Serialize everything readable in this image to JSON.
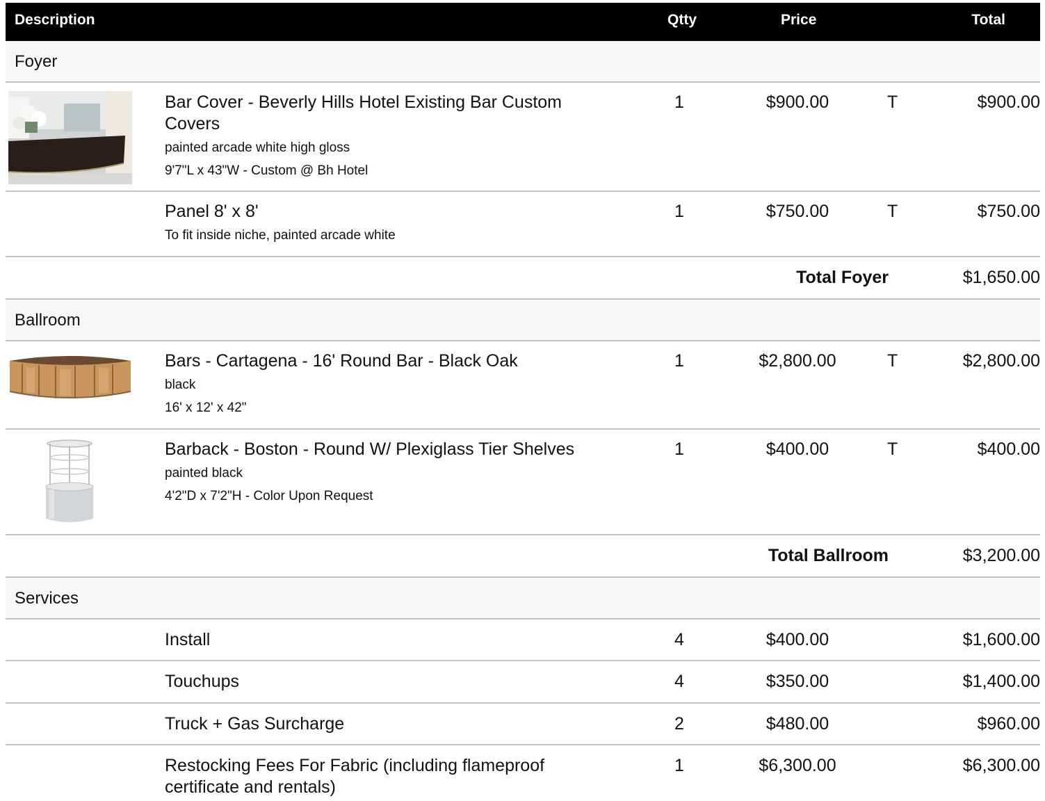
{
  "header": {
    "description": "Description",
    "qty": "Qtty",
    "price": "Price",
    "total": "Total"
  },
  "sections": [
    {
      "name": "Foyer",
      "items": [
        {
          "title": "Bar Cover  - Beverly Hills Hotel Existing Bar Custom Covers",
          "sub1": "painted arcade white high gloss",
          "sub2": "9'7\"L x 43\"W - Custom @ Bh Hotel",
          "qty": "1",
          "price": "$900.00",
          "tax": "T",
          "total": "$900.00"
        },
        {
          "title": "Panel 8' x 8'",
          "sub1": "To fit inside niche, painted arcade white",
          "qty": "1",
          "price": "$750.00",
          "tax": "T",
          "total": "$750.00"
        }
      ],
      "total_label": "Total Foyer",
      "total_value": "$1,650.00"
    },
    {
      "name": "Ballroom",
      "items": [
        {
          "title": "Bars - Cartagena - 16' Round Bar - Black Oak",
          "sub1": "black",
          "sub2": "16' x 12' x 42\"",
          "qty": "1",
          "price": "$2,800.00",
          "tax": "T",
          "total": "$2,800.00"
        },
        {
          "title": "Barback - Boston - Round W/ Plexiglass Tier Shelves",
          "sub1": "painted black",
          "sub2": "4'2\"D x 7'2\"H - Color Upon Request",
          "qty": "1",
          "price": "$400.00",
          "tax": "T",
          "total": "$400.00"
        }
      ],
      "total_label": "Total Ballroom",
      "total_value": "$3,200.00"
    },
    {
      "name": "Services",
      "items": [
        {
          "title": "Install",
          "qty": "4",
          "price": "$400.00",
          "total": "$1,600.00"
        },
        {
          "title": "Touchups",
          "qty": "4",
          "price": "$350.00",
          "total": "$1,400.00"
        },
        {
          "title": "Truck + Gas Surcharge",
          "qty": "2",
          "price": "$480.00",
          "total": "$960.00"
        },
        {
          "title": "Restocking Fees For Fabric (including flameproof certificate and rentals)",
          "qty": "1",
          "price": "$6,300.00",
          "total": "$6,300.00"
        }
      ]
    }
  ]
}
